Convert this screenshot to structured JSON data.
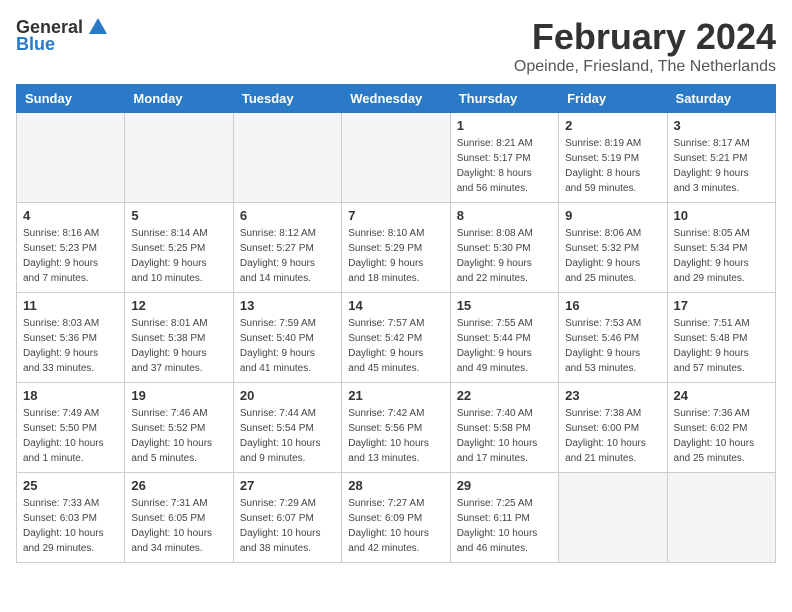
{
  "header": {
    "logo_general": "General",
    "logo_blue": "Blue",
    "month_year": "February 2024",
    "location": "Opeinde, Friesland, The Netherlands"
  },
  "calendar": {
    "weekdays": [
      "Sunday",
      "Monday",
      "Tuesday",
      "Wednesday",
      "Thursday",
      "Friday",
      "Saturday"
    ],
    "weeks": [
      [
        {
          "day": "",
          "info": ""
        },
        {
          "day": "",
          "info": ""
        },
        {
          "day": "",
          "info": ""
        },
        {
          "day": "",
          "info": ""
        },
        {
          "day": "1",
          "info": "Sunrise: 8:21 AM\nSunset: 5:17 PM\nDaylight: 8 hours\nand 56 minutes."
        },
        {
          "day": "2",
          "info": "Sunrise: 8:19 AM\nSunset: 5:19 PM\nDaylight: 8 hours\nand 59 minutes."
        },
        {
          "day": "3",
          "info": "Sunrise: 8:17 AM\nSunset: 5:21 PM\nDaylight: 9 hours\nand 3 minutes."
        }
      ],
      [
        {
          "day": "4",
          "info": "Sunrise: 8:16 AM\nSunset: 5:23 PM\nDaylight: 9 hours\nand 7 minutes."
        },
        {
          "day": "5",
          "info": "Sunrise: 8:14 AM\nSunset: 5:25 PM\nDaylight: 9 hours\nand 10 minutes."
        },
        {
          "day": "6",
          "info": "Sunrise: 8:12 AM\nSunset: 5:27 PM\nDaylight: 9 hours\nand 14 minutes."
        },
        {
          "day": "7",
          "info": "Sunrise: 8:10 AM\nSunset: 5:29 PM\nDaylight: 9 hours\nand 18 minutes."
        },
        {
          "day": "8",
          "info": "Sunrise: 8:08 AM\nSunset: 5:30 PM\nDaylight: 9 hours\nand 22 minutes."
        },
        {
          "day": "9",
          "info": "Sunrise: 8:06 AM\nSunset: 5:32 PM\nDaylight: 9 hours\nand 25 minutes."
        },
        {
          "day": "10",
          "info": "Sunrise: 8:05 AM\nSunset: 5:34 PM\nDaylight: 9 hours\nand 29 minutes."
        }
      ],
      [
        {
          "day": "11",
          "info": "Sunrise: 8:03 AM\nSunset: 5:36 PM\nDaylight: 9 hours\nand 33 minutes."
        },
        {
          "day": "12",
          "info": "Sunrise: 8:01 AM\nSunset: 5:38 PM\nDaylight: 9 hours\nand 37 minutes."
        },
        {
          "day": "13",
          "info": "Sunrise: 7:59 AM\nSunset: 5:40 PM\nDaylight: 9 hours\nand 41 minutes."
        },
        {
          "day": "14",
          "info": "Sunrise: 7:57 AM\nSunset: 5:42 PM\nDaylight: 9 hours\nand 45 minutes."
        },
        {
          "day": "15",
          "info": "Sunrise: 7:55 AM\nSunset: 5:44 PM\nDaylight: 9 hours\nand 49 minutes."
        },
        {
          "day": "16",
          "info": "Sunrise: 7:53 AM\nSunset: 5:46 PM\nDaylight: 9 hours\nand 53 minutes."
        },
        {
          "day": "17",
          "info": "Sunrise: 7:51 AM\nSunset: 5:48 PM\nDaylight: 9 hours\nand 57 minutes."
        }
      ],
      [
        {
          "day": "18",
          "info": "Sunrise: 7:49 AM\nSunset: 5:50 PM\nDaylight: 10 hours\nand 1 minute."
        },
        {
          "day": "19",
          "info": "Sunrise: 7:46 AM\nSunset: 5:52 PM\nDaylight: 10 hours\nand 5 minutes."
        },
        {
          "day": "20",
          "info": "Sunrise: 7:44 AM\nSunset: 5:54 PM\nDaylight: 10 hours\nand 9 minutes."
        },
        {
          "day": "21",
          "info": "Sunrise: 7:42 AM\nSunset: 5:56 PM\nDaylight: 10 hours\nand 13 minutes."
        },
        {
          "day": "22",
          "info": "Sunrise: 7:40 AM\nSunset: 5:58 PM\nDaylight: 10 hours\nand 17 minutes."
        },
        {
          "day": "23",
          "info": "Sunrise: 7:38 AM\nSunset: 6:00 PM\nDaylight: 10 hours\nand 21 minutes."
        },
        {
          "day": "24",
          "info": "Sunrise: 7:36 AM\nSunset: 6:02 PM\nDaylight: 10 hours\nand 25 minutes."
        }
      ],
      [
        {
          "day": "25",
          "info": "Sunrise: 7:33 AM\nSunset: 6:03 PM\nDaylight: 10 hours\nand 29 minutes."
        },
        {
          "day": "26",
          "info": "Sunrise: 7:31 AM\nSunset: 6:05 PM\nDaylight: 10 hours\nand 34 minutes."
        },
        {
          "day": "27",
          "info": "Sunrise: 7:29 AM\nSunset: 6:07 PM\nDaylight: 10 hours\nand 38 minutes."
        },
        {
          "day": "28",
          "info": "Sunrise: 7:27 AM\nSunset: 6:09 PM\nDaylight: 10 hours\nand 42 minutes."
        },
        {
          "day": "29",
          "info": "Sunrise: 7:25 AM\nSunset: 6:11 PM\nDaylight: 10 hours\nand 46 minutes."
        },
        {
          "day": "",
          "info": ""
        },
        {
          "day": "",
          "info": ""
        }
      ]
    ]
  }
}
